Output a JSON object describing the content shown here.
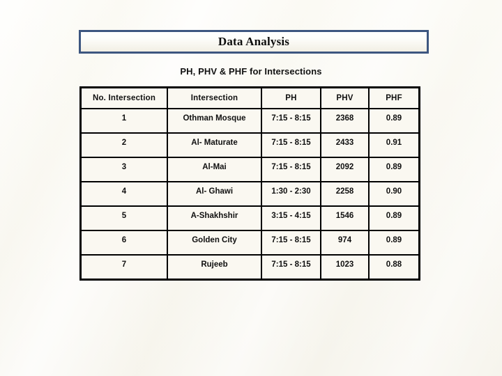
{
  "slide": {
    "title": "Data Analysis",
    "subtitle": "PH, PHV & PHF for Intersections",
    "background_color": "#f8f6ef",
    "title_border_color": "#3d5680",
    "table_border_color": "#000000",
    "table_cell_background": "#faf8f1",
    "text_color": "#101010"
  },
  "table": {
    "columns": [
      "No. Intersection",
      "Intersection",
      "PH",
      "PHV",
      "PHF"
    ],
    "rows": [
      {
        "no": "1",
        "intersection": "Othman Mosque",
        "ph": "7:15 - 8:15",
        "phv": "2368",
        "phf": "0.89"
      },
      {
        "no": "2",
        "intersection": "Al- Maturate",
        "ph": "7:15 - 8:15",
        "phv": "2433",
        "phf": "0.91"
      },
      {
        "no": "3",
        "intersection": "Al-Mai",
        "ph": "7:15 - 8:15",
        "phv": "2092",
        "phf": "0.89"
      },
      {
        "no": "4",
        "intersection": "Al- Ghawi",
        "ph": "1:30 - 2:30",
        "phv": "2258",
        "phf": "0.90"
      },
      {
        "no": "5",
        "intersection": "A-Shakhshir",
        "ph": "3:15 - 4:15",
        "phv": "1546",
        "phf": "0.89"
      },
      {
        "no": "6",
        "intersection": "Golden City",
        "ph": "7:15 - 8:15",
        "phv": "974",
        "phf": "0.89"
      },
      {
        "no": "7",
        "intersection": "Rujeeb",
        "ph": "7:15 - 8:15",
        "phv": "1023",
        "phf": "0.88"
      }
    ]
  }
}
